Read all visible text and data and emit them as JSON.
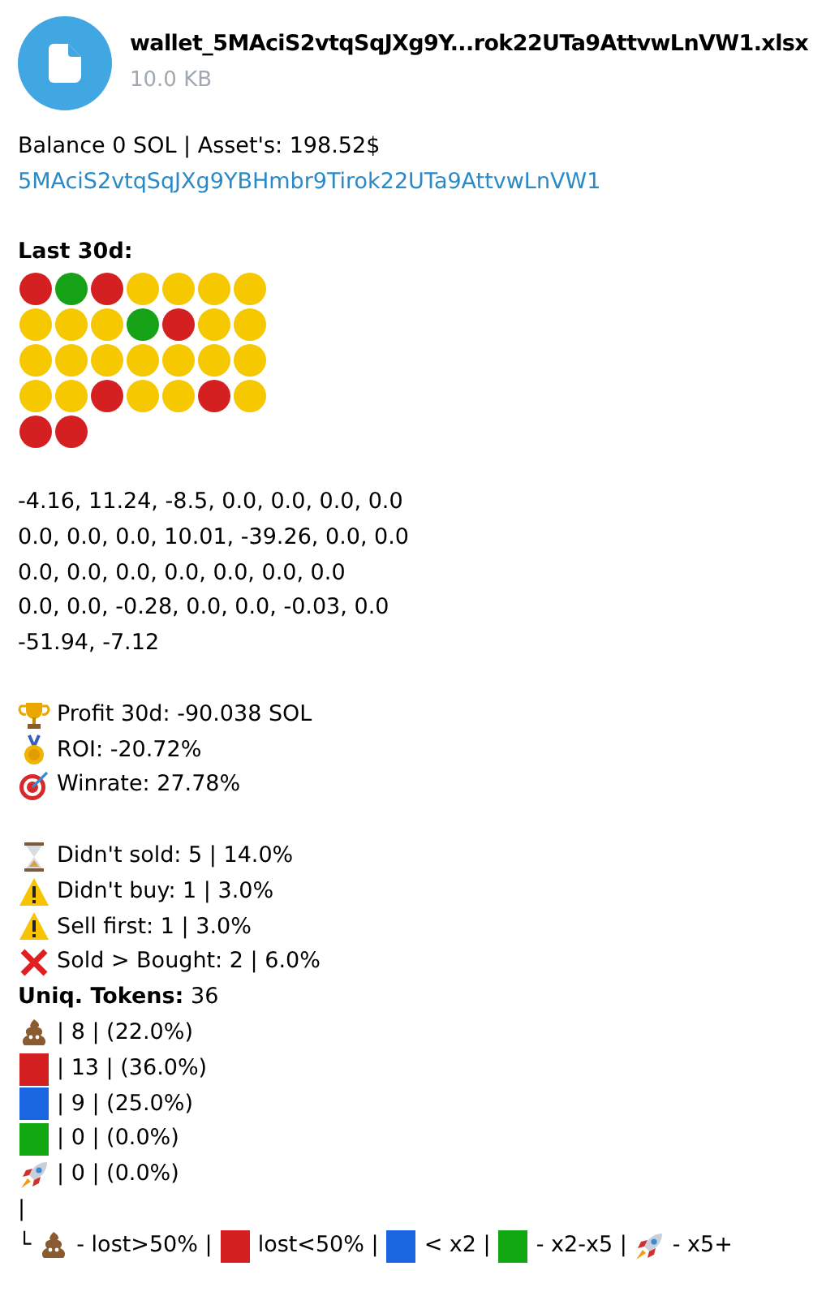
{
  "file": {
    "name": "wallet_5MAciS2vtqSqJXg9Y...rok22UTa9AttvwLnVW1.xlsx",
    "size": "10.0 KB"
  },
  "balance": "Balance 0 SOL | Asset's: 198.52$",
  "address": "5MAciS2vtqSqJXg9YBHmbr9Tirok22UTa9AttvwLnVW1",
  "last30_title": "Last 30d:",
  "dots": [
    {
      "color": "#d42020"
    },
    {
      "color": "#16a216"
    },
    {
      "color": "#d42020"
    },
    {
      "color": "#f5c800"
    },
    {
      "color": "#f5c800"
    },
    {
      "color": "#f5c800"
    },
    {
      "color": "#f5c800"
    },
    {
      "color": "#f5c800"
    },
    {
      "color": "#f5c800"
    },
    {
      "color": "#f5c800"
    },
    {
      "color": "#16a216"
    },
    {
      "color": "#d42020"
    },
    {
      "color": "#f5c800"
    },
    {
      "color": "#f5c800"
    },
    {
      "color": "#f5c800"
    },
    {
      "color": "#f5c800"
    },
    {
      "color": "#f5c800"
    },
    {
      "color": "#f5c800"
    },
    {
      "color": "#f5c800"
    },
    {
      "color": "#f5c800"
    },
    {
      "color": "#f5c800"
    },
    {
      "color": "#f5c800"
    },
    {
      "color": "#f5c800"
    },
    {
      "color": "#d42020"
    },
    {
      "color": "#f5c800"
    },
    {
      "color": "#f5c800"
    },
    {
      "color": "#d42020"
    },
    {
      "color": "#f5c800"
    },
    {
      "color": "#d42020"
    },
    {
      "color": "#d42020"
    }
  ],
  "pnl_lines": [
    "-4.16, 11.24, -8.5, 0.0, 0.0, 0.0, 0.0",
    "0.0, 0.0, 0.0, 10.01, -39.26, 0.0, 0.0",
    "0.0, 0.0, 0.0, 0.0, 0.0, 0.0, 0.0",
    "0.0, 0.0, -0.28, 0.0, 0.0, -0.03, 0.0",
    "-51.94, -7.12"
  ],
  "stats": [
    {
      "kind": "trophy",
      "text": "Profit 30d: -90.038 SOL"
    },
    {
      "kind": "medal",
      "text": "ROI: -20.72%"
    },
    {
      "kind": "target",
      "text": "Winrate: 27.78%"
    }
  ],
  "issues": [
    {
      "kind": "hourglass",
      "text": "Didn't sold: 5 | 14.0%"
    },
    {
      "kind": "warning",
      "text": "Didn't buy: 1 | 3.0%"
    },
    {
      "kind": "warning",
      "text": "Sell first: 1 | 3.0%"
    },
    {
      "kind": "cross",
      "text": "Sold > Bought: 2 | 6.0%"
    }
  ],
  "tokens": {
    "label": "Uniq. Tokens:",
    "value": "36"
  },
  "token_rows": [
    {
      "kind": "poop",
      "text": "| 8 | (22.0%)"
    },
    {
      "kind": "red",
      "text": "| 13 | (36.0%)"
    },
    {
      "kind": "blue",
      "text": "| 9 | (25.0%)"
    },
    {
      "kind": "green",
      "text": "| 0 | (0.0%)"
    },
    {
      "kind": "rocket",
      "text": "| 0 | (0.0%)"
    }
  ],
  "pipe": "|",
  "legend_start": "└",
  "legend": [
    {
      "kind": "poop",
      "text": "- lost>50% |"
    },
    {
      "kind": "red",
      "text": "lost<50% |"
    },
    {
      "kind": "blue",
      "text": "< x2 |"
    },
    {
      "kind": "green",
      "text": "- x2-x5 |"
    },
    {
      "kind": "rocket",
      "text": "- x5+"
    }
  ]
}
